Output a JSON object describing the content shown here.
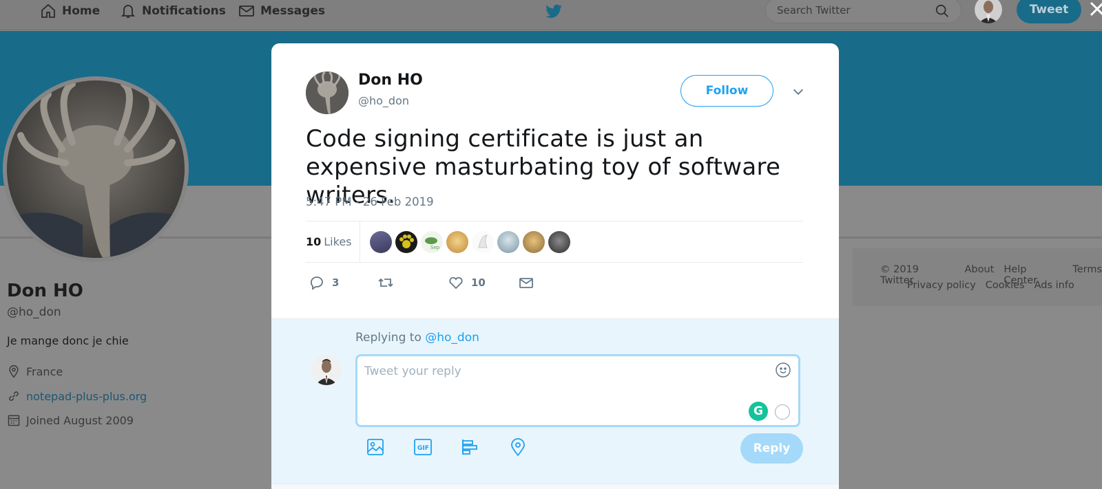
{
  "topnav": {
    "home_label": "Home",
    "notifications_label": "Notifications",
    "messages_label": "Messages",
    "search_placeholder": "Search Twitter",
    "tweet_button": "Tweet"
  },
  "profile": {
    "name": "Don HO",
    "handle": "@ho_don",
    "bio": "Je mange donc je chie",
    "location": "France",
    "website": "notepad-plus-plus.org",
    "joined": "Joined August 2009"
  },
  "footer": {
    "row1": [
      "© 2019 Twitter",
      "About",
      "Help Center",
      "Terms"
    ],
    "row2": [
      "Privacy policy",
      "Cookies",
      "Ads info"
    ]
  },
  "tweet": {
    "author_name": "Don HO",
    "author_handle": "@ho_don",
    "follow_label": "Follow",
    "text": "Code signing certificate is just an expensive masturbating toy of software writers.",
    "timestamp": "5:47 PM - 26 Feb 2019",
    "likes_count": "10",
    "likes_label": "Likes",
    "reply_count": "3",
    "like_action_count": "10"
  },
  "reply": {
    "replying_to_prefix": "Replying to",
    "replying_to_handle": "@ho_don",
    "placeholder": "Tweet your reply",
    "grammarly_letter": "G",
    "submit_label": "Reply"
  },
  "colors": {
    "accent": "#1da1f2",
    "banner": "#196b8a",
    "overlay": "#8a8a8a",
    "reply_bg": "#e8f5fd"
  },
  "icons": [
    "home-icon",
    "bell-icon",
    "mail-icon",
    "twitter-bird-icon",
    "search-icon",
    "close-icon",
    "chevron-down-icon",
    "reply-icon",
    "retweet-icon",
    "heart-icon",
    "direct-message-icon",
    "emoji-icon",
    "image-icon",
    "gif-icon",
    "poll-icon",
    "location-icon",
    "location-pin-icon",
    "link-icon",
    "calendar-icon"
  ]
}
